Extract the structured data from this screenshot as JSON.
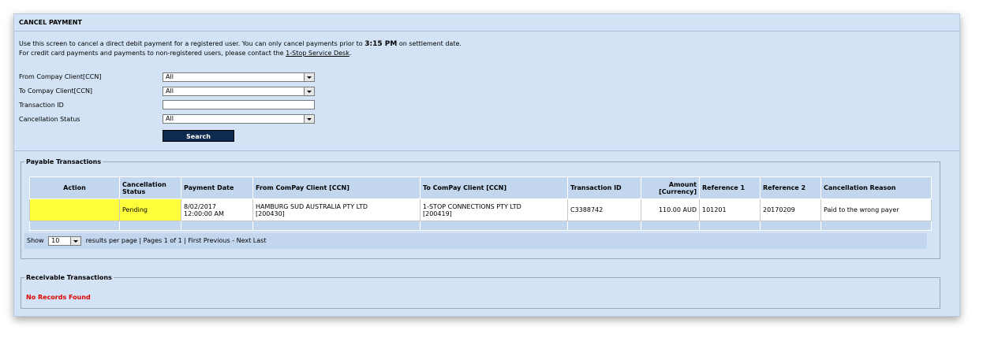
{
  "page": {
    "title": "CANCEL PAYMENT",
    "intro_line1_pre": "Use this screen to cancel a direct debit payment for a registered user. You can only cancel payments prior to",
    "intro_time": "3:15 PM",
    "intro_line1_post": "on settlement date.",
    "intro_line2_pre": "For credit card payments and payments to non-registered users, please contact the",
    "intro_link": "1-Stop Service Desk",
    "intro_line2_post": "."
  },
  "filters": {
    "from_label": "From Compay Client[CCN]",
    "from_value": "All",
    "to_label": "To Compay Client[CCN]",
    "to_value": "All",
    "txn_label": "Transaction ID",
    "txn_value": "",
    "status_label": "Cancellation Status",
    "status_value": "All",
    "search_label": "Search"
  },
  "payable": {
    "legend": "Payable Transactions",
    "headers": [
      "Action",
      "Cancellation Status",
      "Payment Date",
      "From ComPay Client [CCN]",
      "To ComPay Client [CCN]",
      "Transaction ID",
      "Amount [Currency]",
      "Reference 1",
      "Reference 2",
      "Cancellation Reason"
    ],
    "rows": [
      {
        "action": "",
        "status": "Pending",
        "date_line1": "8/02/2017",
        "date_line2": "12:00:00 AM",
        "from_line1": "HAMBURG SUD AUSTRALIA PTY LTD",
        "from_line2": "[200430]",
        "to_line1": "1-STOP CONNECTIONS PTY LTD",
        "to_line2": "[200419]",
        "txn_id": "C3388742",
        "amount": "110.00 AUD",
        "ref1": "101201",
        "ref2": "20170209",
        "reason": "Paid to the wrong payer"
      }
    ],
    "pager": {
      "show": "Show",
      "per_page_value": "10",
      "summary": "results per page | Pages 1 of 1 | First Previous - Next Last"
    }
  },
  "receivable": {
    "legend": "Receivable Transactions",
    "empty_message": "No Records Found"
  },
  "colors": {
    "panel": "#d3e3f5",
    "header": "#c2d6ee",
    "pending": "#ffff3c",
    "search_button": "#0e2a4e",
    "no_records": "#e00000"
  }
}
